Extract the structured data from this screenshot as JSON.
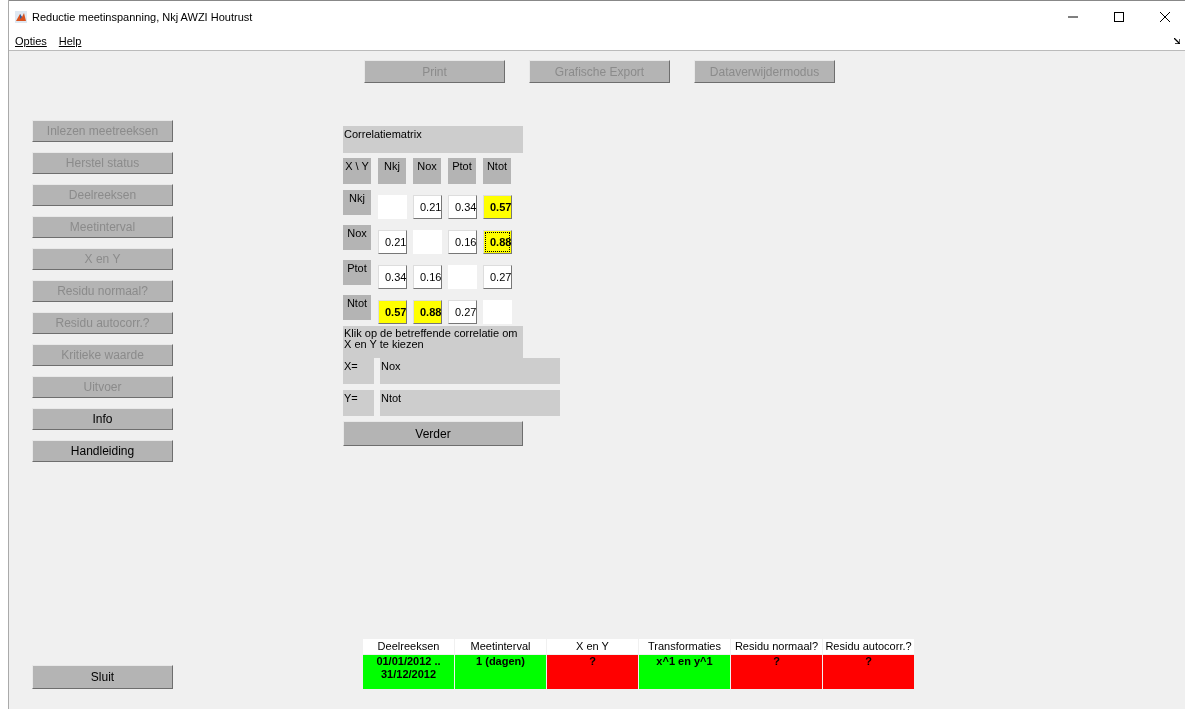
{
  "window": {
    "title": "Reductie meetinspanning, Nkj AWZI Houtrust"
  },
  "menu": [
    "Opties",
    "Help"
  ],
  "toolbar": [
    {
      "label": "Print",
      "disabled": true
    },
    {
      "label": "Grafische Export",
      "disabled": true
    },
    {
      "label": "Dataverwijdermodus",
      "disabled": true
    }
  ],
  "sidebar": [
    {
      "label": "Inlezen meetreeksen",
      "disabled": true
    },
    {
      "label": "Herstel status",
      "disabled": true
    },
    {
      "label": "Deelreeksen",
      "disabled": true
    },
    {
      "label": "Meetinterval",
      "disabled": true
    },
    {
      "label": "X en Y",
      "disabled": true
    },
    {
      "label": "Residu normaal?",
      "disabled": true
    },
    {
      "label": "Residu autocorr.?",
      "disabled": true
    },
    {
      "label": "Kritieke waarde",
      "disabled": true
    },
    {
      "label": "Uitvoer",
      "disabled": true
    },
    {
      "label": "Info",
      "disabled": false
    },
    {
      "label": "Handleiding",
      "disabled": false
    }
  ],
  "close_button": {
    "label": "Sluit"
  },
  "matrix": {
    "title": "Correlatiematrix",
    "corner": "X \\ Y",
    "columns": [
      "Nkj",
      "Nox",
      "Ptot",
      "Ntot"
    ],
    "rows": [
      {
        "label": "Nkj",
        "cells": [
          {
            "kind": "empty"
          },
          {
            "kind": "value",
            "value": "0.21",
            "highlighted": false,
            "focused": false
          },
          {
            "kind": "value",
            "value": "0.34",
            "highlighted": false,
            "focused": false
          },
          {
            "kind": "value",
            "value": "0.57",
            "highlighted": true,
            "focused": false
          }
        ]
      },
      {
        "label": "Nox",
        "cells": [
          {
            "kind": "value",
            "value": "0.21",
            "highlighted": false,
            "focused": false
          },
          {
            "kind": "empty"
          },
          {
            "kind": "value",
            "value": "0.16",
            "highlighted": false,
            "focused": false
          },
          {
            "kind": "value",
            "value": "0.88",
            "highlighted": true,
            "focused": true
          }
        ]
      },
      {
        "label": "Ptot",
        "cells": [
          {
            "kind": "value",
            "value": "0.34",
            "highlighted": false,
            "focused": false
          },
          {
            "kind": "value",
            "value": "0.16",
            "highlighted": false,
            "focused": false
          },
          {
            "kind": "empty"
          },
          {
            "kind": "value",
            "value": "0.27",
            "highlighted": false,
            "focused": false
          }
        ]
      },
      {
        "label": "Ntot",
        "cells": [
          {
            "kind": "value",
            "value": "0.57",
            "highlighted": true,
            "focused": false
          },
          {
            "kind": "value",
            "value": "0.88",
            "highlighted": true,
            "focused": false
          },
          {
            "kind": "value",
            "value": "0.27",
            "highlighted": false,
            "focused": false
          },
          {
            "kind": "empty"
          }
        ]
      }
    ],
    "instruction": "Klik op de betreffende correlatie om X en Y te kiezen",
    "x_label": "X=",
    "x_value": "Nox",
    "y_label": "Y=",
    "y_value": "Ntot",
    "next_button": "Verder"
  },
  "status_table": [
    {
      "header": "Deelreeksen",
      "value": "01/01/2012 .. 31/12/2012",
      "color": "#00ff00"
    },
    {
      "header": "Meetinterval",
      "value": "1 (dagen)",
      "color": "#00ff00"
    },
    {
      "header": "X en Y",
      "value": "?",
      "color": "#ff0000"
    },
    {
      "header": "Transformaties",
      "value": "x^1 en y^1",
      "color": "#00ff00"
    },
    {
      "header": "Residu normaal?",
      "value": "?",
      "color": "#ff0000"
    },
    {
      "header": "Residu autocorr.?",
      "value": "?",
      "color": "#ff0000"
    }
  ]
}
